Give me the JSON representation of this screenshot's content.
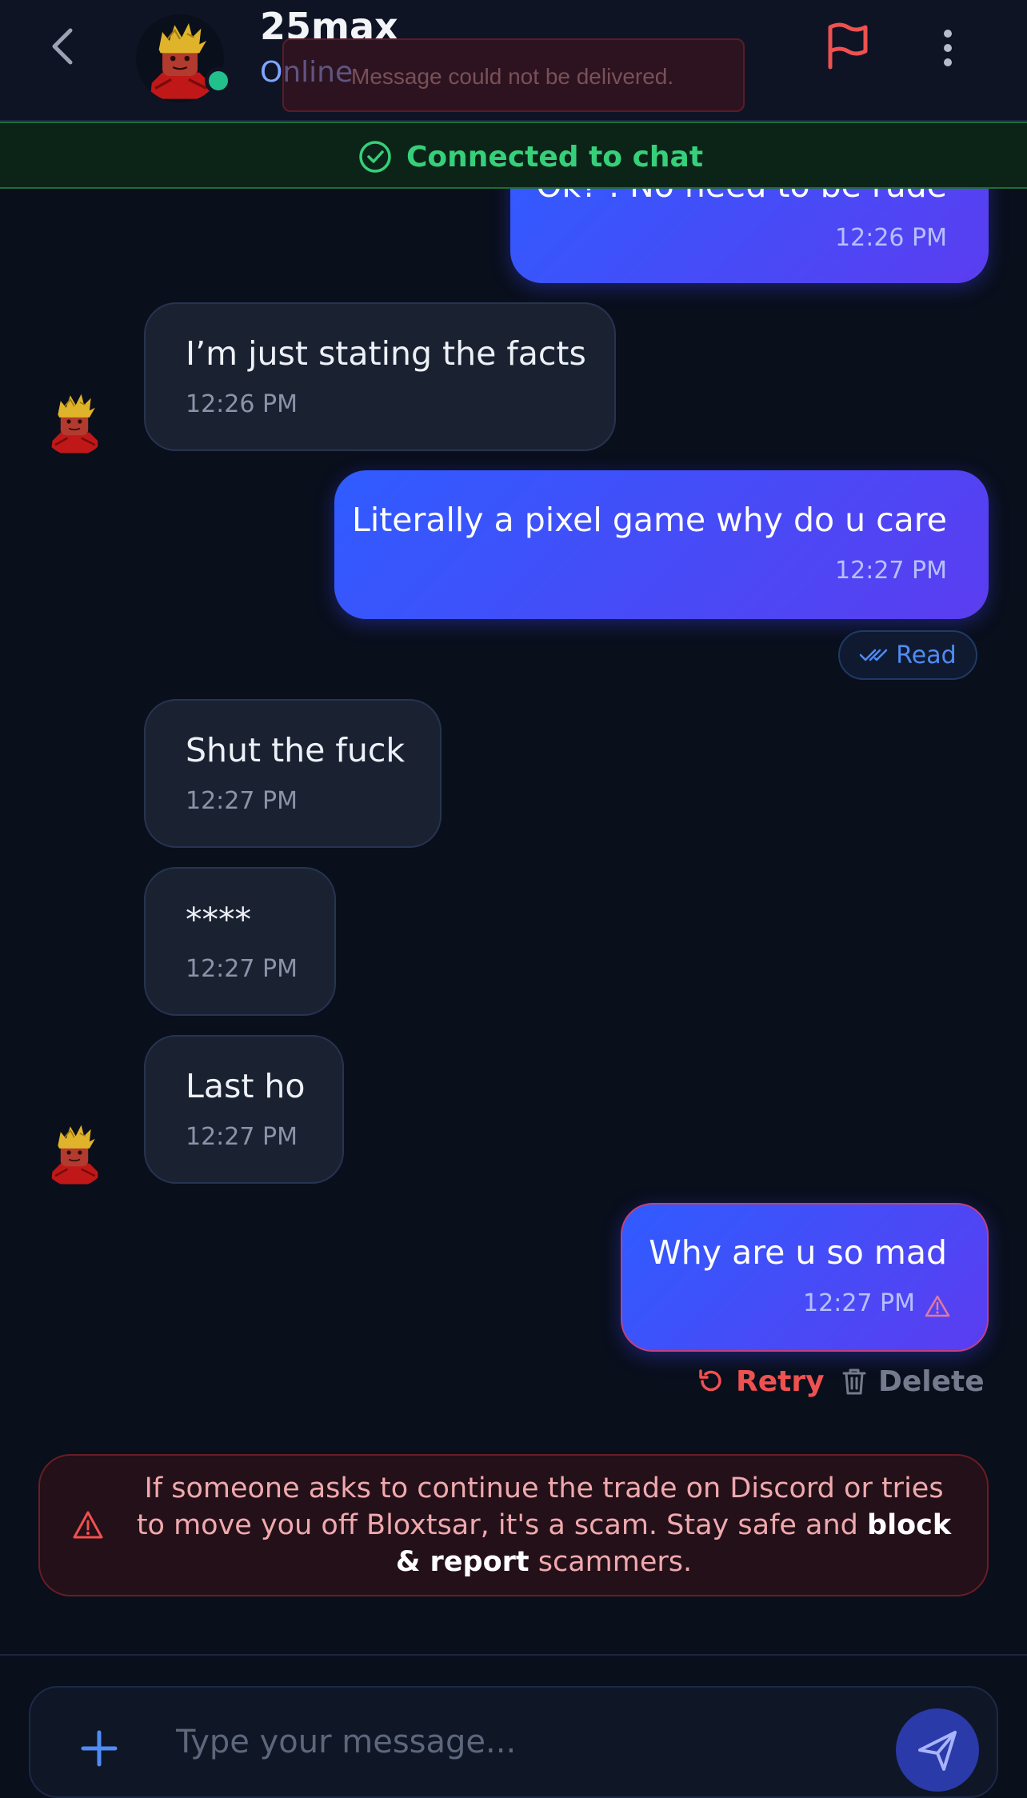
{
  "header": {
    "username": "25max",
    "status": "Online",
    "toast": "Message could not be delivered."
  },
  "connection": {
    "text": "Connected to chat"
  },
  "messages": [
    {
      "dir": "out",
      "text": "Ok? . No need to be rude",
      "time": "12:26 PM"
    },
    {
      "dir": "in",
      "text": "I’m just stating the facts",
      "time": "12:26 PM"
    },
    {
      "dir": "out",
      "text": "Literally a pixel game why do u care",
      "time": "12:27 PM",
      "status": "Read"
    },
    {
      "dir": "in",
      "text": "Shut the fuck",
      "time": "12:27 PM"
    },
    {
      "dir": "in",
      "text": "****",
      "time": "12:27 PM"
    },
    {
      "dir": "in",
      "text": "Last ho",
      "time": "12:27 PM"
    },
    {
      "dir": "out",
      "text": "Why are u so mad",
      "time": "12:27 PM",
      "failed": true
    }
  ],
  "failed_actions": {
    "retry": "Retry",
    "delete": "Delete"
  },
  "warning": {
    "text_before": "If someone asks to continue the trade on Discord or tries to move you off Bloxtsar, it's a scam. Stay safe and ",
    "bold": "block & report",
    "text_after": " scammers."
  },
  "composer": {
    "placeholder": "Type your message..."
  },
  "colors": {
    "accent": "#2f5cff",
    "online": "#22c08a",
    "danger": "#ef5151",
    "connected": "#36d07a"
  },
  "icons": [
    "back-arrow-icon",
    "flag-icon",
    "more-vertical-icon",
    "check-circle-icon",
    "double-check-icon",
    "retry-icon",
    "trash-icon",
    "warning-triangle-icon",
    "plus-icon",
    "send-icon"
  ]
}
